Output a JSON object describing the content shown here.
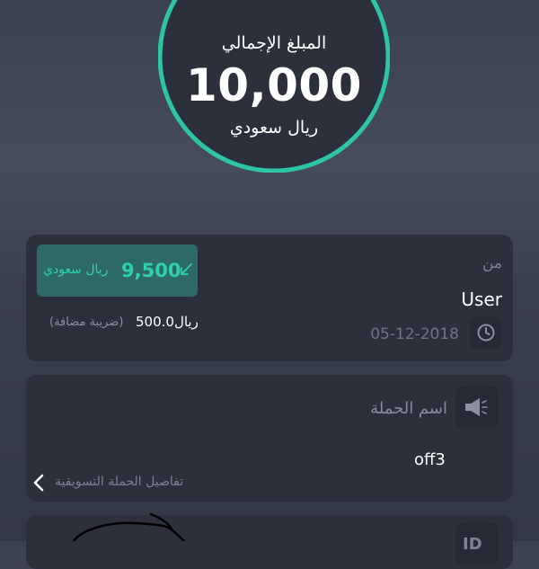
{
  "summary": {
    "label": "المبلغ الإجمالي",
    "amount": "10,000",
    "currency": "ريال سعودي",
    "accent_color": "#2ec5a4",
    "progress_fraction": 0.95
  },
  "from_card": {
    "label": "من",
    "user": "User",
    "date": "05-12-2018",
    "badge_amount": "9,500",
    "badge_currency": "ريال سعودي",
    "tax_value": "500.0ريال",
    "tax_note": "(ضريبة مضافة)"
  },
  "campaign_card": {
    "label": "اسم الحملة",
    "value": "off3",
    "details_link": "تفاصيل الحملة التسويقية"
  },
  "bottom_card": {
    "id_label": "ID"
  },
  "icons": {
    "arrow": "arrow-down-left-icon",
    "clock": "clock-icon",
    "megaphone": "megaphone-icon",
    "chevron": "chevron-left-icon"
  }
}
